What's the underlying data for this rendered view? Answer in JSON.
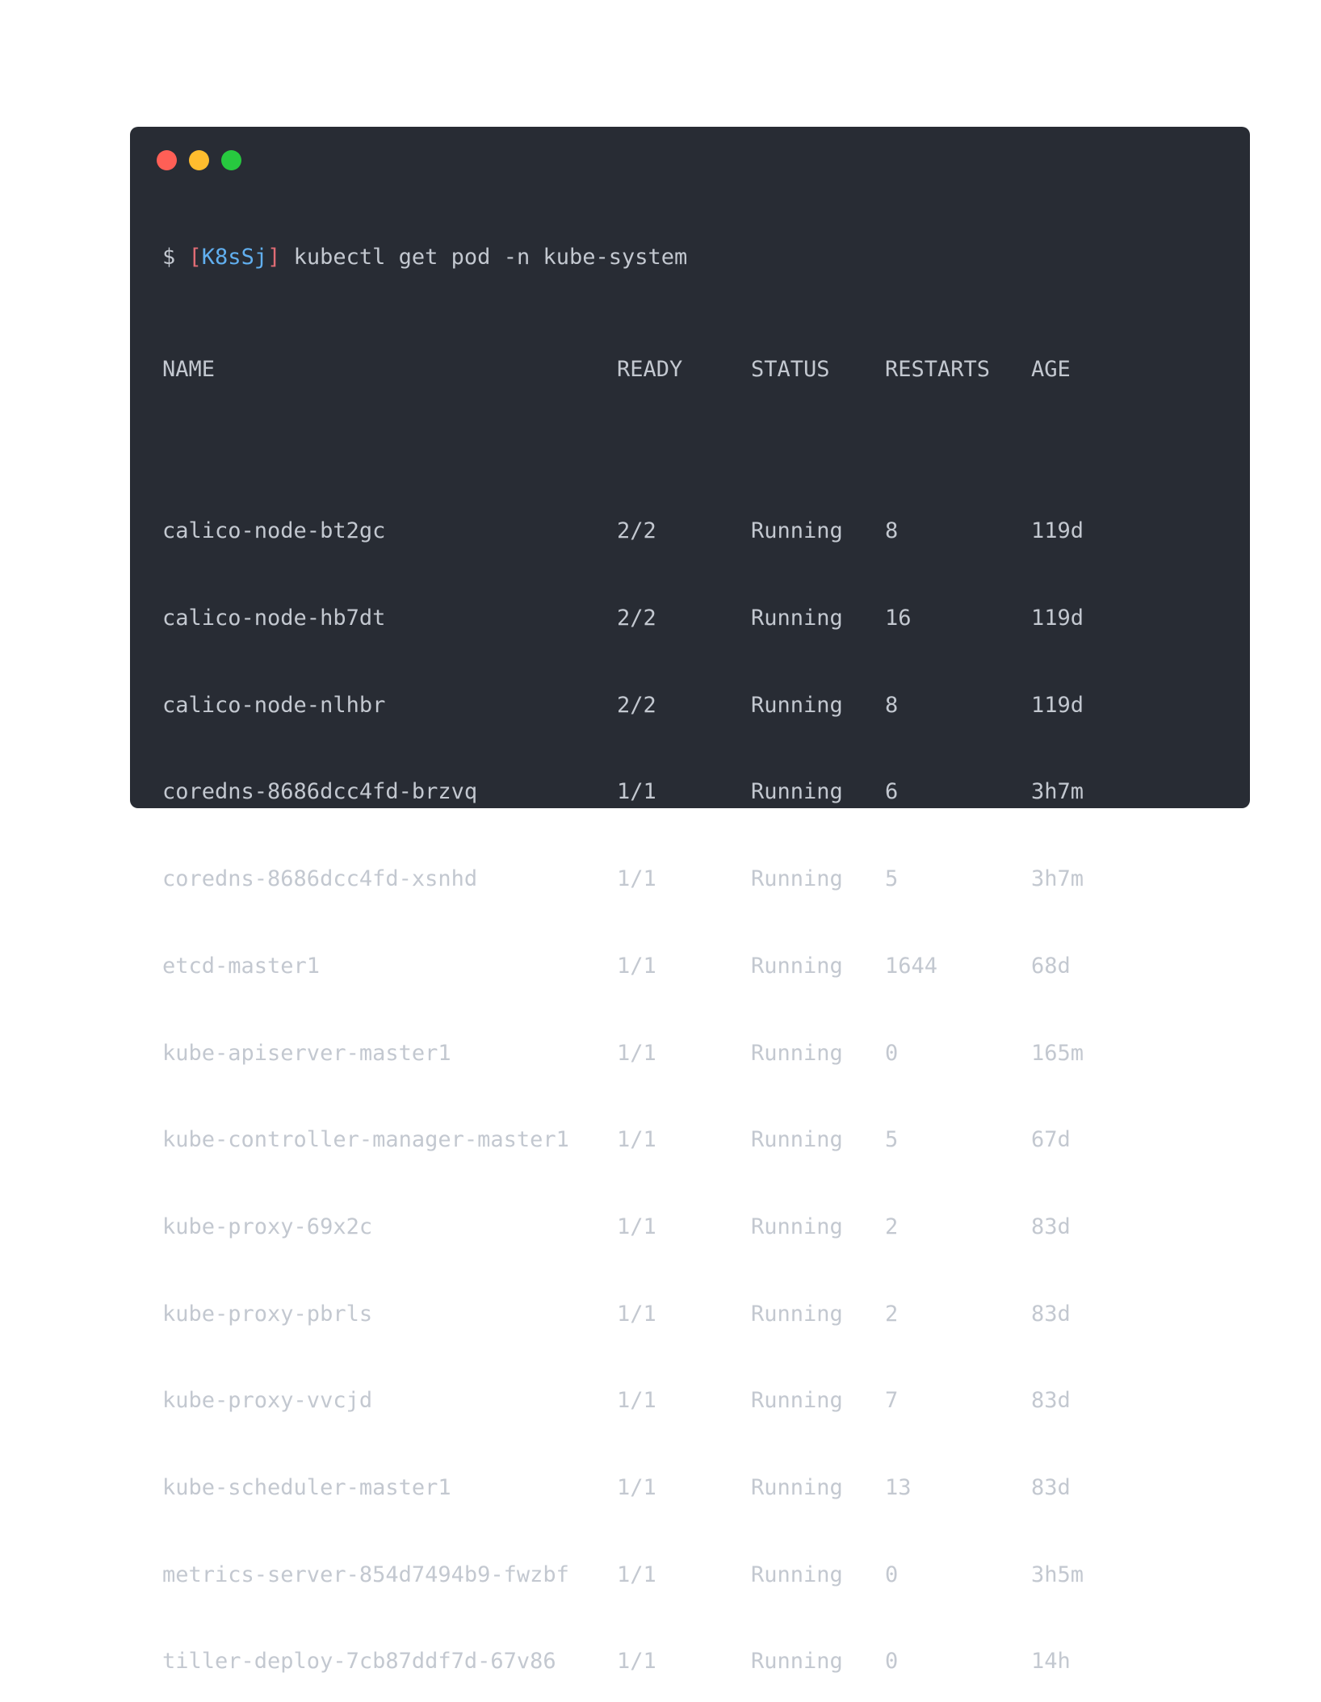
{
  "window": {
    "controls": [
      {
        "name": "close-dot",
        "color": "#ff5f56"
      },
      {
        "name": "minimize-dot",
        "color": "#ffbd2e"
      },
      {
        "name": "maximize-dot",
        "color": "#27c93f"
      }
    ]
  },
  "prompt": {
    "symbol": "$",
    "open_bracket": "[",
    "context": "K8sSj",
    "close_bracket": "]",
    "command": "kubectl get pod -n kube-system"
  },
  "table": {
    "headers": {
      "name": "NAME",
      "ready": "READY",
      "status": "STATUS",
      "restarts": "RESTARTS",
      "age": "AGE"
    },
    "rows": [
      {
        "name": "calico-node-bt2gc",
        "ready": "2/2",
        "status": "Running",
        "restarts": "8",
        "age": "119d"
      },
      {
        "name": "calico-node-hb7dt",
        "ready": "2/2",
        "status": "Running",
        "restarts": "16",
        "age": "119d"
      },
      {
        "name": "calico-node-nlhbr",
        "ready": "2/2",
        "status": "Running",
        "restarts": "8",
        "age": "119d"
      },
      {
        "name": "coredns-8686dcc4fd-brzvq",
        "ready": "1/1",
        "status": "Running",
        "restarts": "6",
        "age": "3h7m"
      },
      {
        "name": "coredns-8686dcc4fd-xsnhd",
        "ready": "1/1",
        "status": "Running",
        "restarts": "5",
        "age": "3h7m"
      },
      {
        "name": "etcd-master1",
        "ready": "1/1",
        "status": "Running",
        "restarts": "1644",
        "age": "68d"
      },
      {
        "name": "kube-apiserver-master1",
        "ready": "1/1",
        "status": "Running",
        "restarts": "0",
        "age": "165m"
      },
      {
        "name": "kube-controller-manager-master1",
        "ready": "1/1",
        "status": "Running",
        "restarts": "5",
        "age": "67d"
      },
      {
        "name": "kube-proxy-69x2c",
        "ready": "1/1",
        "status": "Running",
        "restarts": "2",
        "age": "83d"
      },
      {
        "name": "kube-proxy-pbrls",
        "ready": "1/1",
        "status": "Running",
        "restarts": "2",
        "age": "83d"
      },
      {
        "name": "kube-proxy-vvcjd",
        "ready": "1/1",
        "status": "Running",
        "restarts": "7",
        "age": "83d"
      },
      {
        "name": "kube-scheduler-master1",
        "ready": "1/1",
        "status": "Running",
        "restarts": "13",
        "age": "83d"
      },
      {
        "name": "metrics-server-854d7494b9-fwzbf",
        "ready": "1/1",
        "status": "Running",
        "restarts": "0",
        "age": "3h5m"
      },
      {
        "name": "tiller-deploy-7cb87ddf7d-67v86",
        "ready": "1/1",
        "status": "Running",
        "restarts": "0",
        "age": "14h"
      }
    ]
  },
  "colors": {
    "background": "#282c34",
    "text": "#c3c8d0",
    "bracket": "#e06c75",
    "context": "#61afef"
  }
}
